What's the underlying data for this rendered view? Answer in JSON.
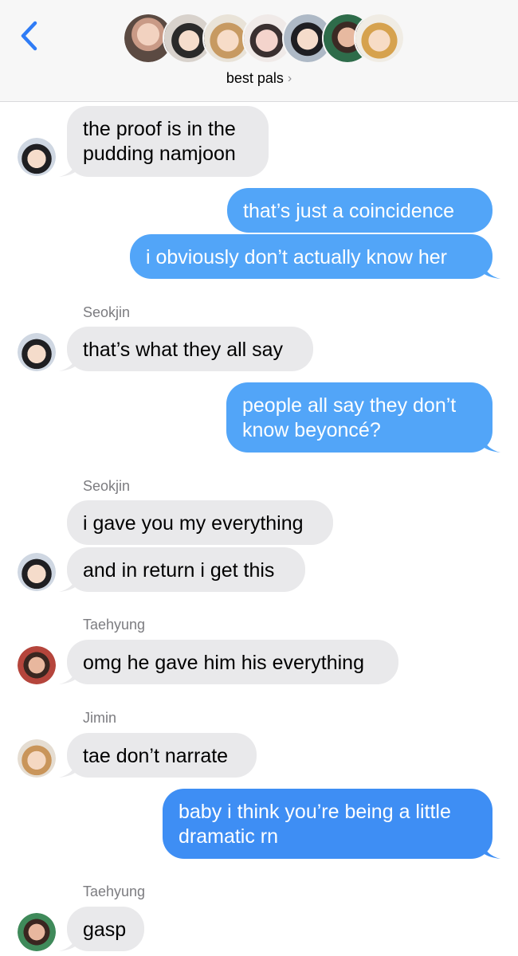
{
  "header": {
    "group_name": "best pals",
    "chevron": "›",
    "back_icon": "chevron-left-icon",
    "member_avatar_count": 7
  },
  "messages": [
    {
      "side": "left",
      "text_lines": [
        "the proof is in the",
        "pudding namjoon"
      ]
    },
    {
      "side": "right",
      "text_lines": [
        "that’s just a coincidence"
      ]
    },
    {
      "side": "right",
      "text_lines": [
        "i obviously don’t actually know her"
      ]
    },
    {
      "sender": "Seokjin"
    },
    {
      "side": "left",
      "text_lines": [
        "that’s what they all say"
      ]
    },
    {
      "side": "right",
      "text_lines": [
        "people all say they don’t",
        "know beyoncé?"
      ]
    },
    {
      "sender": "Seokjin"
    },
    {
      "side": "left",
      "text_lines": [
        "i gave you my everything"
      ]
    },
    {
      "side": "left",
      "text_lines": [
        "and in return i get this"
      ]
    },
    {
      "sender": "Taehyung"
    },
    {
      "side": "left",
      "text_lines": [
        "omg he gave him his everything"
      ]
    },
    {
      "sender": "Jimin"
    },
    {
      "side": "left",
      "text_lines": [
        "tae don’t narrate"
      ]
    },
    {
      "side": "right",
      "text_lines": [
        "baby i think you’re being a little",
        "dramatic rn"
      ]
    },
    {
      "sender": "Taehyung"
    },
    {
      "side": "left",
      "text_lines": [
        "gasp"
      ]
    }
  ],
  "colors": {
    "sent_bubble": "#52a5f8",
    "received_bubble": "#e9e9eb",
    "accent": "#2f7cf6"
  }
}
